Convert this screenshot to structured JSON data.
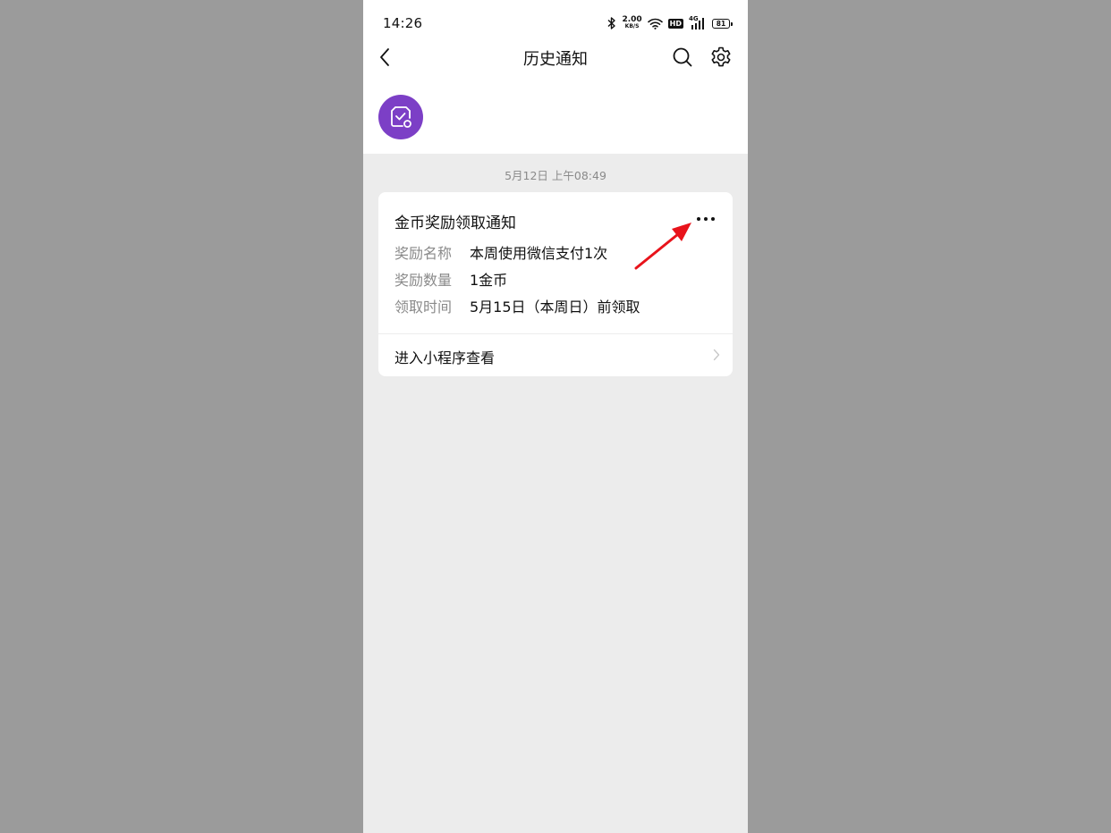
{
  "status_bar": {
    "time": "14:26",
    "net_speed_value": "2.00",
    "net_speed_unit": "KB/S",
    "hd_label": "HD",
    "network_type": "4G",
    "battery_level": "81"
  },
  "nav": {
    "title": "历史通知"
  },
  "notification": {
    "timestamp": "5月12日 上午08:49",
    "title": "金币奖励领取通知",
    "fields": [
      {
        "label": "奖励名称",
        "value": "本周使用微信支付1次"
      },
      {
        "label": "奖励数量",
        "value": "1金币"
      },
      {
        "label": "领取时间",
        "value": "5月15日（本周日）前领取"
      }
    ],
    "link_label": "进入小程序查看"
  },
  "colors": {
    "page_background": "#9b9b9b",
    "content_background": "#ececec",
    "avatar_background": "#7c3fc6",
    "annotation_arrow": "#e8131b"
  },
  "icons": {
    "back": "chevron-left-icon",
    "search": "search-icon",
    "settings": "gear-icon",
    "more": "more-dots-icon",
    "avatar": "coin-check-icon",
    "link": "chevron-right-icon"
  }
}
